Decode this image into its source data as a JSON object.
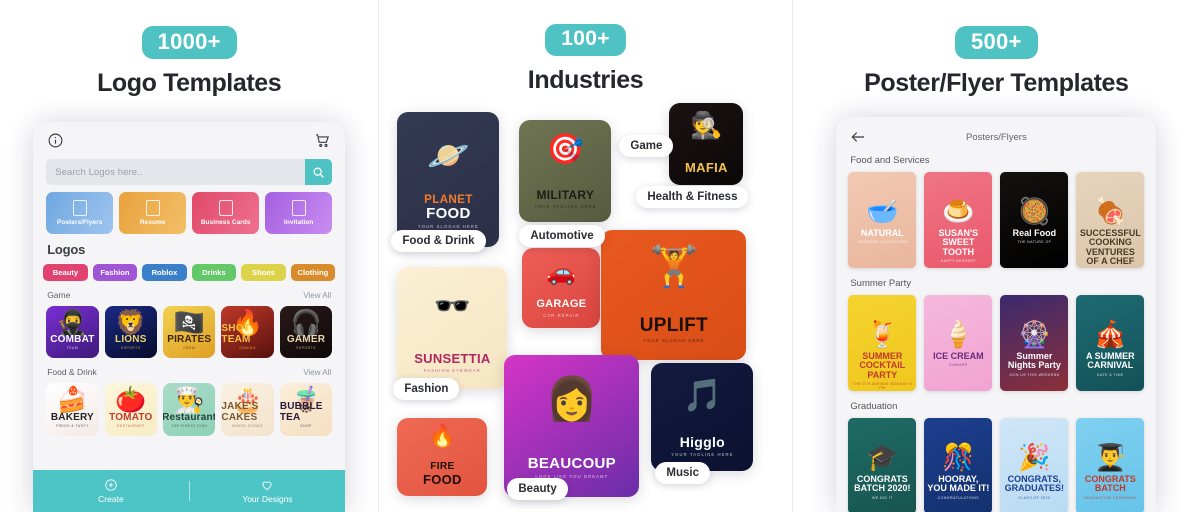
{
  "panels": [
    {
      "badge": "1000+",
      "title": "Logo Templates",
      "app": {
        "info_icon": "info-icon",
        "cart_icon": "cart-icon",
        "search_placeholder": "Search Logos here..",
        "search_icon": "search-icon",
        "tiles": [
          {
            "label": "Posters/Flyers",
            "color": "#6fa8e0",
            "color2": "#9fc4ef",
            "icon": "image-icon"
          },
          {
            "label": "Resume",
            "color": "#e9a13b",
            "color2": "#f3c06a",
            "icon": "document-icon"
          },
          {
            "label": "Business Cards",
            "color": "#e04a68",
            "color2": "#ef7090",
            "icon": "card-icon"
          },
          {
            "label": "Invitation",
            "color": "#a45fe0",
            "color2": "#c98df2",
            "icon": "invite-icon"
          }
        ],
        "section_title": "Logos",
        "chips": [
          {
            "label": "Beauty",
            "color": "#e0436f"
          },
          {
            "label": "Fashion",
            "color": "#a055d6"
          },
          {
            "label": "Roblox",
            "color": "#3b7ec9"
          },
          {
            "label": "Drinks",
            "color": "#63c867"
          },
          {
            "label": "Shoes",
            "color": "#ddd košt"
          },
          {
            "label": "Clothing",
            "color": "#d98b2b"
          }
        ],
        "rows": [
          {
            "title": "Game",
            "view_all": "View All",
            "items": [
              {
                "name": "COMBAT",
                "sub": "TEAM",
                "bg1": "#7b2fd4",
                "bg2": "#3d1a7a",
                "text": "#ffffff",
                "emblem": "🥷"
              },
              {
                "name": "LIONS",
                "sub": "ESPORTS",
                "bg1": "#1a2a86",
                "bg2": "#070c2a",
                "text": "#f0d46a",
                "emblem": "🦁"
              },
              {
                "name": "PIRATES",
                "sub": "CREW",
                "bg1": "#f2d14e",
                "bg2": "#e0a024",
                "text": "#3a2410",
                "emblem": "🏴‍☠️"
              },
              {
                "name": "SHOT TEAM",
                "sub": "GAMING",
                "bg1": "#c0392b",
                "bg2": "#56110d",
                "text": "#f5c542",
                "emblem": "🔥"
              },
              {
                "name": "GAMER",
                "sub": "ESPORTS",
                "bg1": "#2b1a1a",
                "bg2": "#0d0808",
                "text": "#e8d9b0",
                "emblem": "🎧"
              }
            ]
          },
          {
            "title": "Food & Drink",
            "view_all": "View All",
            "items": [
              {
                "name": "BAKERY",
                "sub": "FRESH & TASTY",
                "bg1": "#ffffff",
                "bg2": "#f3eae6",
                "text": "#23242a",
                "emblem": "🍰"
              },
              {
                "name": "TOMATO",
                "sub": "RESTAURANT",
                "bg1": "#fdf6dc",
                "bg2": "#f7ecc4",
                "text": "#c0392b",
                "emblem": "🍅"
              },
              {
                "name": "Restaurant",
                "sub": "THE FINEST DISH",
                "bg1": "#a9ddc8",
                "bg2": "#8ed0b7",
                "text": "#1f4036",
                "emblem": "👨‍🍳"
              },
              {
                "name": "JAKE'S CAKES",
                "sub": "BAKED GOODS",
                "bg1": "#faf1e2",
                "bg2": "#f2e3cc",
                "text": "#7a5a2e",
                "emblem": "🎂"
              },
              {
                "name": "BUBBLE TEA",
                "sub": "SHOP",
                "bg1": "#fbeedb",
                "bg2": "#f5dfc0",
                "text": "#2c1a3d",
                "emblem": "🧋"
              }
            ]
          }
        ],
        "bottom": [
          {
            "label": "Create",
            "icon": "plus-circle-icon"
          },
          {
            "label": "Your Designs",
            "icon": "heart-icon"
          }
        ]
      }
    },
    {
      "badge": "100+",
      "title": "Industries",
      "cards": [
        {
          "name": "PLANET FOOD",
          "line1": "PLANET",
          "line2": "FOOD",
          "sub": "YOUR SLOGAN HERE",
          "bg1": "#343a52",
          "bg2": "#2b3048",
          "accent": "#f07a2e",
          "text": "#ffffff",
          "emblem": "🪐"
        },
        {
          "name": "MILITARY",
          "line1": "MILITARY",
          "line2": "",
          "sub": "YOUR TAGLINE HERE",
          "bg1": "#6f7553",
          "bg2": "#565b3f",
          "accent": "#f2c14e",
          "text": "#1d1d16",
          "emblem": "🎯"
        },
        {
          "name": "MAFIA",
          "line1": "MAFIA",
          "line2": "",
          "sub": "",
          "bg1": "#1a1212",
          "bg2": "#0c0808",
          "accent": "#f2c14e",
          "text": "#f2c14e",
          "emblem": "🕵️"
        },
        {
          "name": "SUNSETTIA",
          "line1": "SUNSETTIA",
          "line2": "",
          "sub": "FASHION EYEWEAR",
          "bg1": "#fbf0d5",
          "bg2": "#f5e6c2",
          "accent": "#c2276b",
          "text": "#b3265f",
          "emblem": "🕶️"
        },
        {
          "name": "GARAGE",
          "line1": "GARAGE",
          "line2": "",
          "sub": "CAR REPAIR",
          "bg1": "#ef5f57",
          "bg2": "#d9453e",
          "accent": "#ffffff",
          "text": "#ffffff",
          "emblem": "🚗"
        },
        {
          "name": "UPLIFT",
          "line1": "UPLIFT",
          "line2": "",
          "sub": "YOUR SLOGAN HERE",
          "bg1": "#e8591f",
          "bg2": "#d94d16",
          "accent": "#1a1008",
          "text": "#1a1008",
          "emblem": "🏋️"
        },
        {
          "name": "BEAUCOUP",
          "line1": "BEAUCOUP",
          "line2": "",
          "sub": "LOOK LIKE YOU DREAMT",
          "bg1": "#d634c7",
          "bg2": "#6a2ea8",
          "accent": "#ffffff",
          "text": "#ffffff",
          "emblem": "👩"
        },
        {
          "name": "FIRE FOOD",
          "line1": "FIRE",
          "line2": "FOOD",
          "sub": "",
          "bg1": "#ef6a55",
          "bg2": "#e2543f",
          "accent": "#1a1008",
          "text": "#1a1008",
          "emblem": "🔥"
        },
        {
          "name": "Higglo",
          "line1": "Higglo",
          "line2": "",
          "sub": "YOUR TAGLINE HERE",
          "bg1": "#131a3f",
          "bg2": "#0c1130",
          "accent": "#f0a8c0",
          "text": "#ffffff",
          "emblem": "🎵"
        }
      ],
      "pills": [
        "Food & Drink",
        "Game",
        "Automotive",
        "Health & Fitness",
        "Fashion",
        "Beauty",
        "Music"
      ]
    },
    {
      "badge": "500+",
      "title": "Poster/Flyer Templates",
      "app": {
        "back_icon": "back-arrow-icon",
        "header_title": "Posters/Flyers",
        "sections": [
          {
            "title": "Food and Services",
            "posters": [
              {
                "title": "NATURAL",
                "sub": "SKINCARE COLLECTION",
                "bg1": "#f2c9b4",
                "bg2": "#e9b69c",
                "text": "#ffffff",
                "emblem": "🥣"
              },
              {
                "title": "SUSAN'S SWEET TOOTH",
                "sub": "HAPPY DESSERT",
                "bg1": "#ef7585",
                "bg2": "#e9596c",
                "text": "#ffffff",
                "emblem": "🍮"
              },
              {
                "title": "Real Food",
                "sub": "THE NATURE OF",
                "bg1": "#14120f",
                "bg2": "#000000",
                "text": "#ffffff",
                "emblem": "🥘"
              },
              {
                "title": "SUCCESSFUL COOKING VENTURES OF A CHEF",
                "sub": "AN",
                "bg1": "#e6d4bd",
                "bg2": "#dcc6ab",
                "text": "#4a3a26",
                "emblem": "🍖"
              }
            ]
          },
          {
            "title": "Summer Party",
            "posters": [
              {
                "title": "SUMMER COCKTAIL PARTY",
                "sub": "THE 5TH AVENUE MONDAY 9 PM",
                "bg1": "#f5d32e",
                "bg2": "#efc71e",
                "text": "#c0392b",
                "emblem": "🍹"
              },
              {
                "title": "ICE CREAM",
                "sub": "SUMMER",
                "bg1": "#f6b8dd",
                "bg2": "#f0a3d2",
                "text": "#6a2a7a",
                "emblem": "🍦"
              },
              {
                "title": "Summer Nights Party",
                "sub": "JOIN US THIS WEEKEND",
                "bg1": "#3a2a6e",
                "bg2": "#8c2f3a",
                "text": "#ffffff",
                "emblem": "🎡"
              },
              {
                "title": "A SUMMER CARNIVAL",
                "sub": "DATE & TIME",
                "bg1": "#1e6b73",
                "bg2": "#145158",
                "text": "#ffffff",
                "emblem": "🎪"
              }
            ]
          },
          {
            "title": "Graduation",
            "posters": [
              {
                "title": "CONGRATS BATCH 2020!",
                "sub": "WE DID IT",
                "bg1": "#1f6b66",
                "bg2": "#17544f",
                "text": "#ffffff",
                "emblem": "🎓"
              },
              {
                "title": "HOORAY, YOU MADE IT!",
                "sub": "CONGRATULATIONS",
                "bg1": "#1c3f8f",
                "bg2": "#14306e",
                "text": "#ffffff",
                "emblem": "🎊"
              },
              {
                "title": "CONGRATS, GRADUATES!",
                "sub": "CLASS OF 2020",
                "bg1": "#cfe6f7",
                "bg2": "#b9dbf3",
                "text": "#1c3f8f",
                "emblem": "🎉"
              },
              {
                "title": "CONGRATS BATCH",
                "sub": "GRADUATION CEREMONY",
                "bg1": "#7fd0f0",
                "bg2": "#66c3e9",
                "text": "#c0392b",
                "emblem": "👨‍🎓"
              }
            ]
          }
        ]
      }
    }
  ]
}
